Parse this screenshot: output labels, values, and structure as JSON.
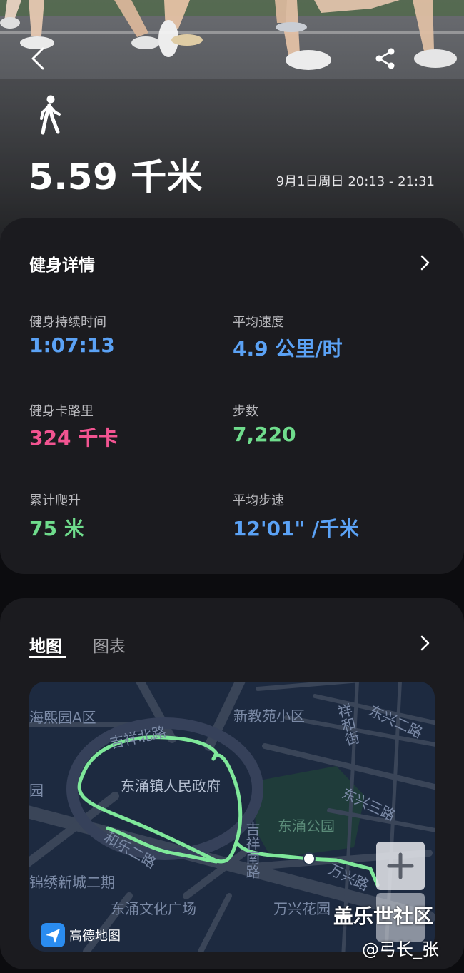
{
  "header": {
    "distance": "5.59 千米",
    "session_time": "9月1日周日 20:13 - 21:31",
    "activity_icon": "walk-icon",
    "back_icon": "chevron-left-icon",
    "share_icon": "share-icon"
  },
  "details": {
    "title": "健身详情",
    "stats": [
      {
        "label": "健身持续时间",
        "value": "1:07:13",
        "color": "#5ba2f5"
      },
      {
        "label": "平均速度",
        "value": "4.9 公里/时",
        "color": "#5ba2f5"
      },
      {
        "label": "健身卡路里",
        "value": "324 千卡",
        "color": "#f25491"
      },
      {
        "label": "步数",
        "value": "7,220",
        "color": "#6fdc8c"
      },
      {
        "label": "累计爬升",
        "value": "75 米",
        "color": "#6fdc8c"
      },
      {
        "label": "平均步速",
        "value": "12'01\" /千米",
        "color": "#5ba2f5"
      }
    ]
  },
  "map_card": {
    "tabs": [
      {
        "label": "地图",
        "active": true
      },
      {
        "label": "图表",
        "active": false
      }
    ],
    "map_labels": {
      "a": "海熙园A区",
      "b": "新教苑小区",
      "c": "祥和街",
      "d": "东兴二路",
      "e": "吉祥北路",
      "f": "东涌镇人民政府",
      "g": "园",
      "h": "东兴三路",
      "i": "东涌公园",
      "j": "和乐二路",
      "k": "吉祥南路",
      "l": "锦绣新城二期",
      "m": "万兴路",
      "n": "东涌文化广场",
      "o": "万兴花园"
    },
    "map_provider": "高德地图",
    "route_color": "#7fe89a"
  },
  "watermark": {
    "site": "盖乐世社区",
    "user": "@弓长_张"
  }
}
